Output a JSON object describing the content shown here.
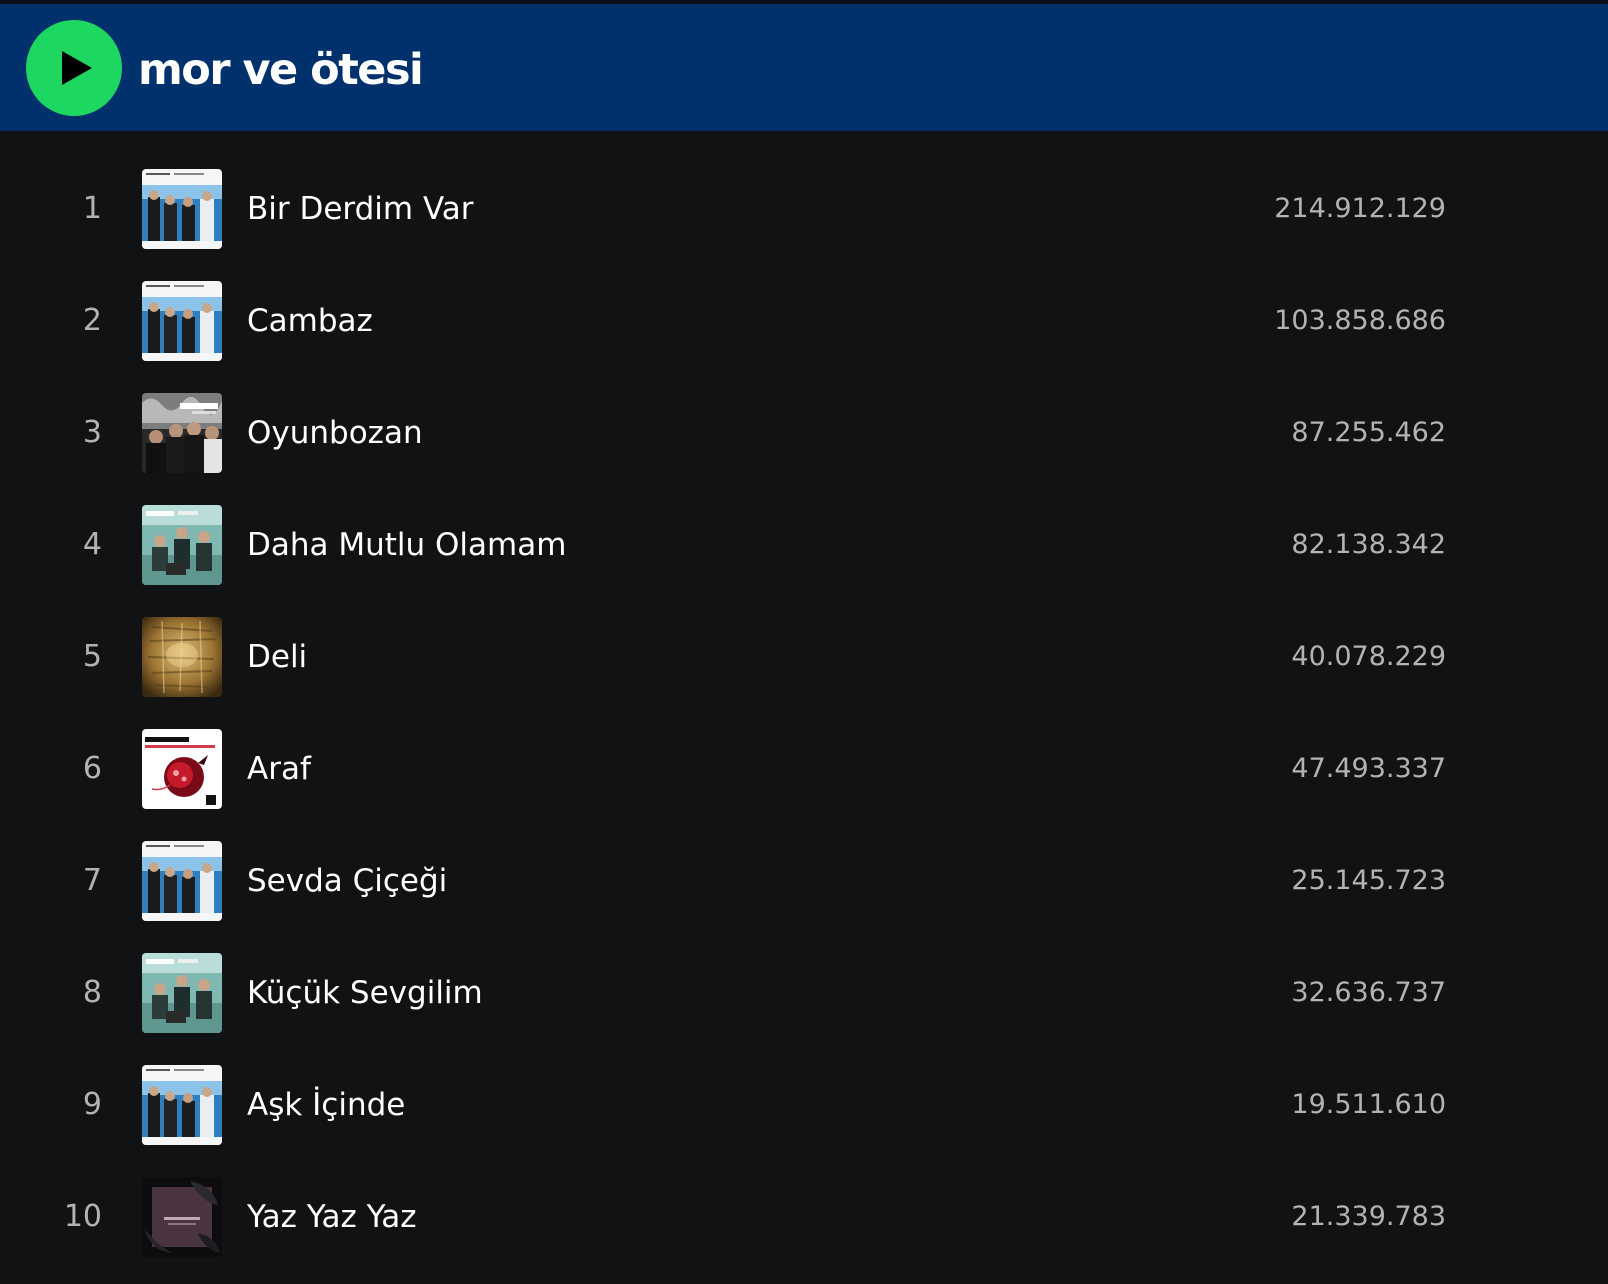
{
  "header": {
    "artist_name": "mor ve ötesi",
    "play_icon": "play-icon",
    "background_color": "#00316d",
    "accent_color": "#1ed760"
  },
  "tracks": [
    {
      "number": "1",
      "title": "Bir Derdim Var",
      "plays": "214.912.129",
      "art": "album-art-blue-band"
    },
    {
      "number": "2",
      "title": "Cambaz",
      "plays": "103.858.686",
      "art": "album-art-blue-band"
    },
    {
      "number": "3",
      "title": "Oyunbozan",
      "plays": "87.255.462",
      "art": "album-art-dark-band"
    },
    {
      "number": "4",
      "title": "Daha Mutlu Olamam",
      "plays": "82.138.342",
      "art": "album-art-teal-band"
    },
    {
      "number": "5",
      "title": "Deli",
      "plays": "40.078.229",
      "art": "album-art-gold-texture"
    },
    {
      "number": "6",
      "title": "Araf",
      "plays": "47.493.337",
      "art": "album-art-pomegranate"
    },
    {
      "number": "7",
      "title": "Sevda Çiçeği",
      "plays": "25.145.723",
      "art": "album-art-blue-band"
    },
    {
      "number": "8",
      "title": "Küçük Sevgilim",
      "plays": "32.636.737",
      "art": "album-art-teal-band"
    },
    {
      "number": "9",
      "title": "Aşk İçinde",
      "plays": "19.511.610",
      "art": "album-art-blue-band"
    },
    {
      "number": "10",
      "title": "Yaz Yaz Yaz",
      "plays": "21.339.783",
      "art": "album-art-dark-leaves"
    }
  ]
}
